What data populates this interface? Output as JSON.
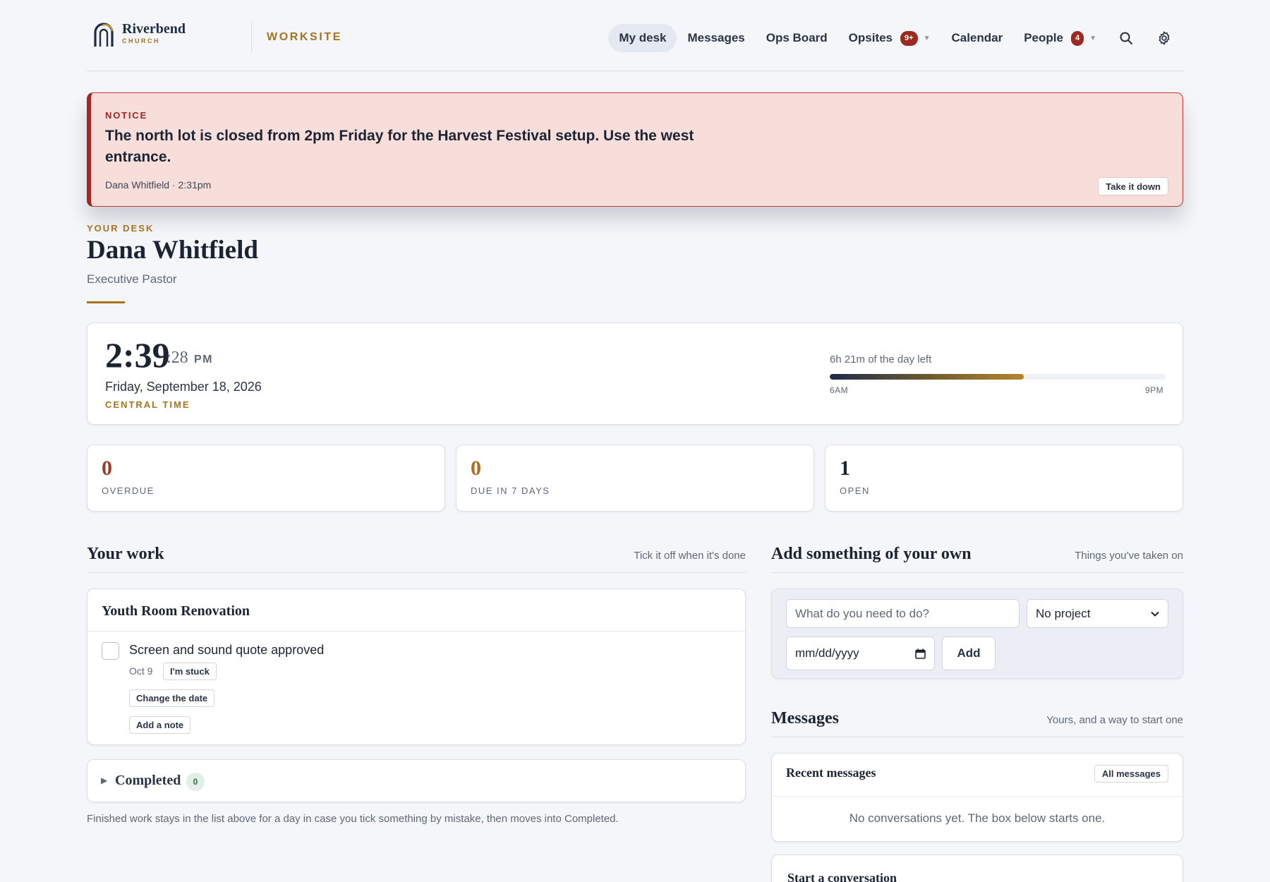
{
  "brand": {
    "name": "Riverbend",
    "sub": "CHURCH",
    "section": "WORKSITE"
  },
  "nav": {
    "items": [
      {
        "label": "My desk",
        "active": true
      },
      {
        "label": "Messages"
      },
      {
        "label": "Ops Board"
      },
      {
        "label": "Opsites",
        "badge": "9+"
      },
      {
        "label": "Calendar"
      },
      {
        "label": "People",
        "badge": "4"
      }
    ],
    "icons": [
      "search-icon",
      "gear-icon"
    ]
  },
  "notice": {
    "kicker": "NOTICE",
    "text": "The north lot is closed from 2pm Friday for the Harvest Festival setup. Use the west entrance.",
    "meta": "Dana Whitfield · 2:31pm",
    "action": "Take it down"
  },
  "desk": {
    "kicker": "YOUR DESK",
    "name": "Dana Whitfield",
    "role": "Executive Pastor"
  },
  "clock": {
    "time": "2:39",
    "seconds": ":28",
    "ampm": "PM",
    "date": "Friday, September 18, 2026",
    "timezone": "CENTRAL TIME",
    "day_left": "6h 21m of the day left",
    "day_start": "6AM",
    "day_end": "9PM",
    "day_progress_fraction": 0.577
  },
  "stats": [
    {
      "value": "0",
      "label": "OVERDUE",
      "color": "#9c3a26"
    },
    {
      "value": "0",
      "label": "DUE IN 7 DAYS",
      "color": "#b26a1c"
    },
    {
      "value": "1",
      "label": "OPEN",
      "color": "#1c2434"
    }
  ],
  "work": {
    "title": "Your work",
    "aside": "Tick it off when it's done",
    "project": "Youth Room Renovation",
    "task": {
      "title": "Screen and sound quote approved",
      "date": "Oct 9",
      "stuck": "I'm stuck",
      "change_date": "Change the date",
      "add_note": "Add a note"
    },
    "completed": {
      "label": "Completed",
      "count": "0"
    },
    "hint": "Finished work stays in the list above for a day in case you tick something by mistake, then moves into Completed."
  },
  "add": {
    "title": "Add something of your own",
    "aside": "Things you've taken on",
    "placeholder": "What do you need to do?",
    "project_select": "No project",
    "date_placeholder": "mm/dd/yyyy",
    "button": "Add"
  },
  "messages": {
    "title": "Messages",
    "aside": "Yours, and a way to start one",
    "recent_title": "Recent messages",
    "all_button": "All messages",
    "empty": "No conversations yet. The box below starts one.",
    "start_title": "Start a conversation"
  }
}
